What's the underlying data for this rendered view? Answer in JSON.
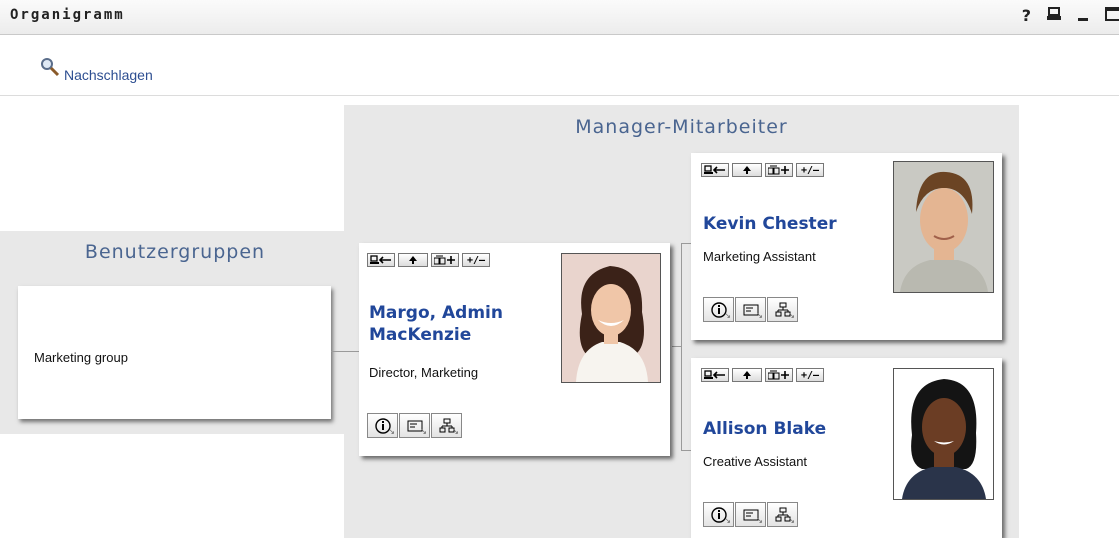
{
  "window": {
    "title": "Organigramm",
    "controls": [
      "?",
      "print-icon",
      "minimize-icon",
      "maximize-icon"
    ]
  },
  "toolbar": {
    "lookup_label": "Nachschlagen",
    "lookup_icon": "magnifier-icon"
  },
  "groups_panel": {
    "title": "Benutzergruppen",
    "group_name": "Marketing group"
  },
  "manager_panel": {
    "title": "Manager-Mitarbeiter"
  },
  "card_buttons": [
    "show-as-root",
    "go-up",
    "show-subordinates",
    "expand-collapse"
  ],
  "card_button_labels": [
    "+/–"
  ],
  "manager": {
    "name_line1": "Margo, Admin",
    "name_line2": "MacKenzie",
    "role": "Director, Marketing"
  },
  "employees": [
    {
      "name": "Kevin Chester",
      "role": "Marketing Assistant"
    },
    {
      "name": "Allison Blake",
      "role": "Creative Assistant"
    }
  ],
  "action_buttons": [
    "info-icon",
    "email-icon",
    "org-chart-icon"
  ],
  "colors": {
    "accent": "#21479a",
    "panel_bg": "#e8e8e8",
    "title_color": "#4a6590"
  }
}
